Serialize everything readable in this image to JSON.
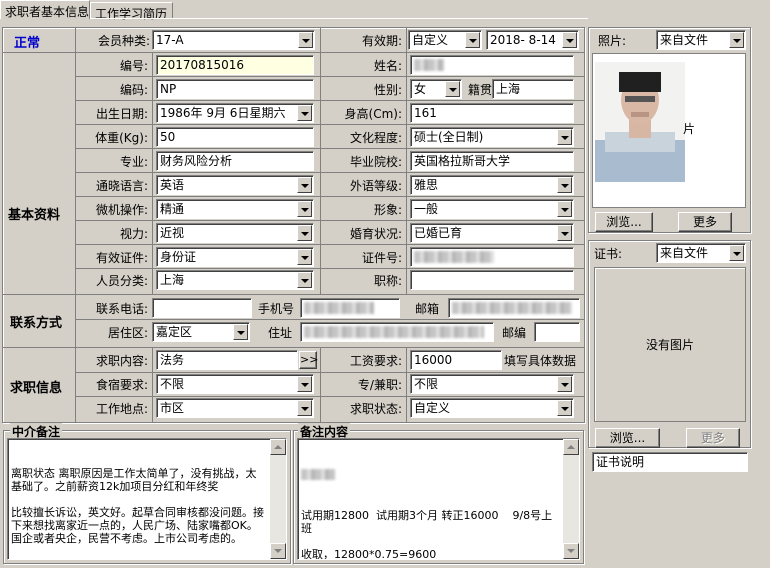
{
  "tabs": [
    "求职者基本信息",
    "工作学习简历"
  ],
  "status": "正常",
  "status_color": "#0000cc",
  "sections": {
    "basic": "基本资料",
    "contact": "联系方式",
    "job": "求职信息"
  },
  "labels": {
    "member_type": "会员种类:",
    "validity": "有效期:",
    "number": "编号:",
    "name": "姓名:",
    "code": "编码:",
    "gender": "性别:",
    "native_place": "籍贯",
    "birth_date": "出生日期:",
    "height": "身高(Cm):",
    "weight": "体重(Kg):",
    "education": "文化程度:",
    "major": "专业:",
    "school": "毕业院校:",
    "language": "通晓语言:",
    "foreign_level": "外语等级:",
    "computer": "微机操作:",
    "appearance": "形象:",
    "vision": "视力:",
    "marital": "婚育状况:",
    "id_doc": "有效证件:",
    "id_no": "证件号:",
    "person_class": "人员分类:",
    "title": "职称:",
    "phone": "联系电话:",
    "mobile": "手机号",
    "email": "邮箱",
    "district": "居住区:",
    "address": "住址",
    "zip": "邮编",
    "job_content": "求职内容:",
    "salary": "工资要求:",
    "salary_hint": "填写具体数据",
    "board": "食宿要求:",
    "fulltime": "专/兼职:",
    "location": "工作地点:",
    "job_status": "求职状态:",
    "photo": "照片:",
    "certificate": "证书:"
  },
  "values": {
    "member_type": "17-A",
    "validity_mode": "自定义",
    "validity_date": "2018- 8-14",
    "number": "20170815016",
    "name": "",
    "code": "NP",
    "gender": "女",
    "native_place": "上海",
    "birth_date": "1986年 9月 6日星期六",
    "height": "161",
    "weight": "50",
    "education": "硕士(全日制)",
    "major": "财务风险分析",
    "school": "英国格拉斯哥大学",
    "language": "英语",
    "foreign_level": "雅思",
    "computer": "精通",
    "appearance": "一般",
    "vision": "近视",
    "marital": "已婚已育",
    "id_doc": "身份证",
    "id_no": "",
    "person_class": "上海",
    "title": "",
    "phone": "",
    "mobile": "",
    "email": "",
    "district": "嘉定区",
    "address": "",
    "zip": "",
    "job_content": "法务",
    "salary": "16000",
    "board": "不限",
    "fulltime": "不限",
    "location": "市区",
    "job_status": "自定义",
    "photo_source": "来自文件",
    "cert_source": "来自文件"
  },
  "buttons": {
    "browse": "浏览...",
    "more": "更多",
    "cert_browse": "浏览...",
    "cert_more": "更多",
    "expand": ">>"
  },
  "photo_side_char": "片",
  "cert_no_image": "没有图片",
  "cert_desc": "证书说明",
  "memo": {
    "agent_title": "中介备注",
    "agent_text": "离职状态 离职原因是工作太简单了，没有挑战，太基础了。之前薪资12k加项目分红和年终奖\n\n比较擅长诉讼，英文好。起草合同审核都没问题。接下来想找离家近一点的，人民广场、陆家嘴都OK。\n国企或者央企，民营不考虑。上市公司考虑的。",
    "note_title": "备注内容",
    "note_text": "试用期12800  试用期3个月 转正16000    9/8号上班\n\n收取，12800*0.75=9600"
  }
}
